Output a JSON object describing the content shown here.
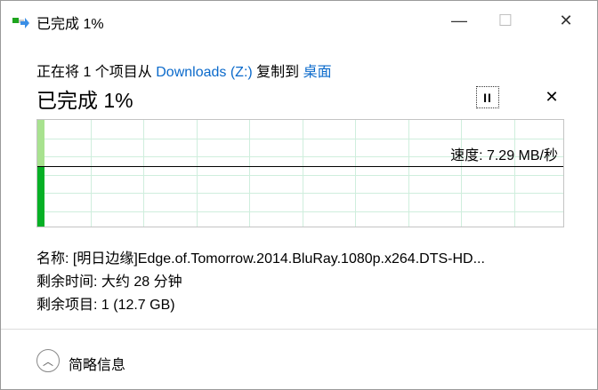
{
  "window": {
    "title": "已完成 1%",
    "minimize": "—",
    "maximize": "☐",
    "close": "✕"
  },
  "header": {
    "prefix": "正在将 1 个项目从 ",
    "source": "Downloads (Z:)",
    "middle": " 复制到 ",
    "dest": "桌面",
    "progress_label": "已完成 1%",
    "progress_percent": 1,
    "pause_label": "II",
    "stop_label": "✕"
  },
  "graph": {
    "speed_label": "速度: 7.29 MB/秒",
    "speed_level_fraction": 0.57,
    "accent": "#06b025",
    "accent_light": "#a8e28f"
  },
  "details": {
    "name": "名称:  [明日边缘]Edge.of.Tomorrow.2014.BluRay.1080p.x264.DTS-HD...",
    "time_left": "剩余时间: 大约 28 分钟",
    "items_left": "剩余项目: 1 (12.7 GB)"
  },
  "footer": {
    "toggle_icon": "︿",
    "toggle_label": "简略信息"
  }
}
